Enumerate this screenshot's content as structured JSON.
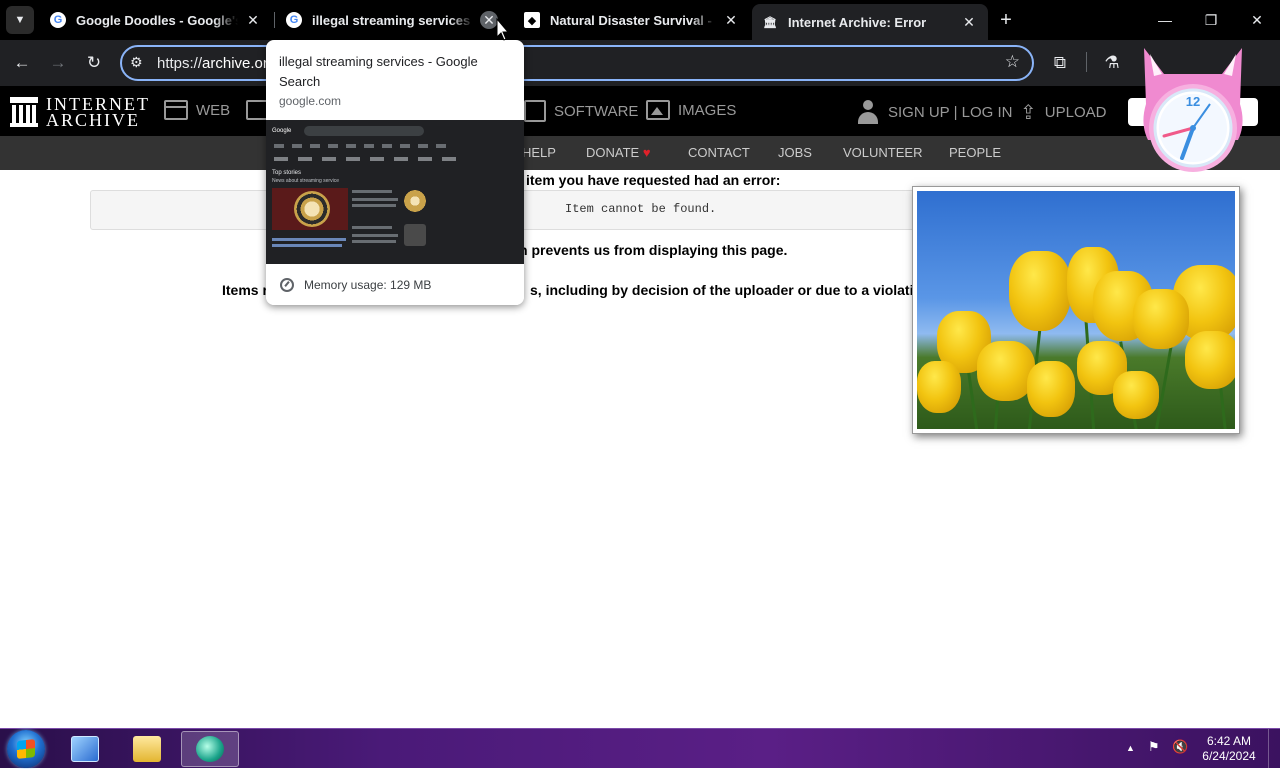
{
  "browser": {
    "tabs": [
      {
        "title": "Google Doodles - Google's Se",
        "favicon": "google-icon",
        "active": false
      },
      {
        "title": "illegal streaming services - Goo",
        "favicon": "google-icon",
        "active": false,
        "hovered": true
      },
      {
        "title": "Natural Disaster Survival - Rob",
        "favicon": "roblox-icon",
        "active": false
      },
      {
        "title": "Internet Archive: Error",
        "favicon": "internet-archive-icon",
        "active": true
      }
    ],
    "close_glyph": "✕",
    "newtab_glyph": "+",
    "url_scheme": "https://",
    "url_host": "archive.org",
    "window_controls": {
      "minimize": "—",
      "restore": "❐",
      "close": "✕"
    }
  },
  "hover_card": {
    "title": "illegal streaming services - Google Search",
    "domain": "google.com",
    "memory": "Memory usage: 129 MB",
    "thumbnail": {
      "logo": "Google",
      "section": "Top stories",
      "subsection": "News about streaming service"
    }
  },
  "archive": {
    "logo_line1": "INTERNET",
    "logo_line2": "ARCHIVE",
    "nav": {
      "web": "WEB",
      "software": "SOFTWARE",
      "images": "IMAGES"
    },
    "signup": "SIGN UP | LOG IN",
    "upload": "UPLOAD",
    "subnav": {
      "help": "HELP",
      "donate": "DONATE",
      "heart": "♥",
      "contact": "CONTACT",
      "jobs": "JOBS",
      "volunteer": "VOLUNTEER",
      "people": "PEOPLE"
    }
  },
  "error": {
    "heading": "item you have requested had an error:",
    "message": "Item cannot be found.",
    "line2": "n prevents us from displaying this page.",
    "line3a": "Items r",
    "line3b": "s, including by decision of the uploader or due to a violation"
  },
  "gadgets": {
    "clock_number": "12"
  },
  "taskbar": {
    "time": "6:42 AM",
    "date": "6/24/2024"
  },
  "colors": {
    "accent_focus": "#8ab4f8",
    "taskbar_purple": "#4a1a78",
    "donate_heart": "#e0212a"
  }
}
